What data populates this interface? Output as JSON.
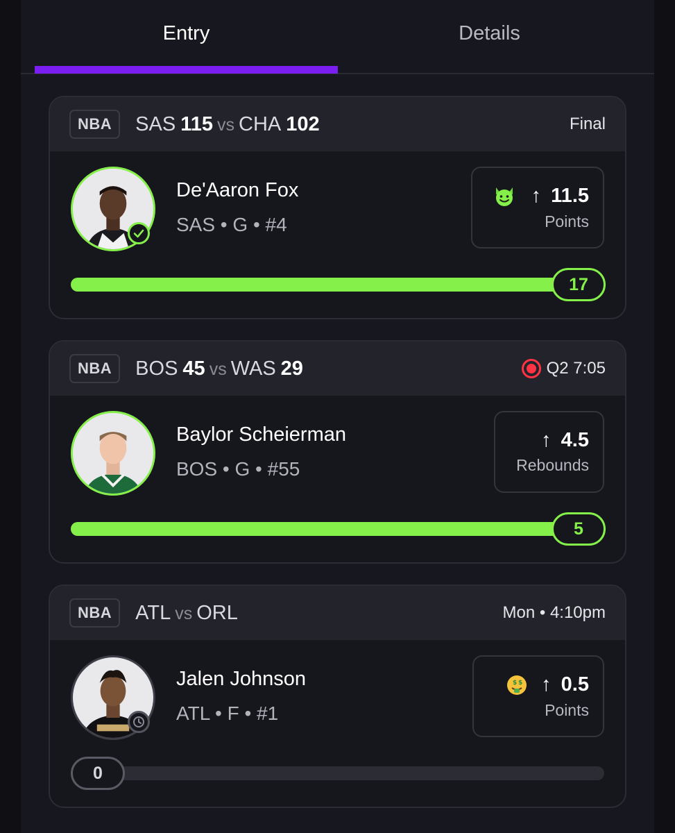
{
  "tabs": {
    "entry": "Entry",
    "details": "Details"
  },
  "colors": {
    "accent": "#7a1ef2",
    "success": "#86f04a",
    "live": "#ff3344"
  },
  "cards": [
    {
      "league": "NBA",
      "home": "SAS",
      "home_score": "115",
      "vs": "vs",
      "away": "CHA",
      "away_score": "102",
      "status": "Final",
      "player": {
        "name": "De'Aaron Fox",
        "meta": "SAS • G • #4"
      },
      "pick": {
        "direction_icon": "arrow-up-icon",
        "line": "11.5",
        "stat": "Points",
        "emoji": "devil-emoji"
      },
      "progress": {
        "value": "17",
        "fraction": 1.0
      }
    },
    {
      "league": "NBA",
      "home": "BOS",
      "home_score": "45",
      "vs": "vs",
      "away": "WAS",
      "away_score": "29",
      "status": "Q2 7:05",
      "player": {
        "name": "Baylor Scheierman",
        "meta": "BOS • G • #55"
      },
      "pick": {
        "direction_icon": "arrow-up-icon",
        "line": "4.5",
        "stat": "Rebounds"
      },
      "progress": {
        "value": "5",
        "fraction": 1.0
      }
    },
    {
      "league": "NBA",
      "home": "ATL",
      "vs": "vs",
      "away": "ORL",
      "status": "Mon • 4:10pm",
      "player": {
        "name": "Jalen Johnson",
        "meta": "ATL • F • #1"
      },
      "pick": {
        "direction_icon": "arrow-up-icon",
        "line": "0.5",
        "stat": "Points",
        "emoji": "money-mouth-emoji"
      },
      "progress": {
        "value": "0",
        "fraction": 0.0
      }
    }
  ]
}
